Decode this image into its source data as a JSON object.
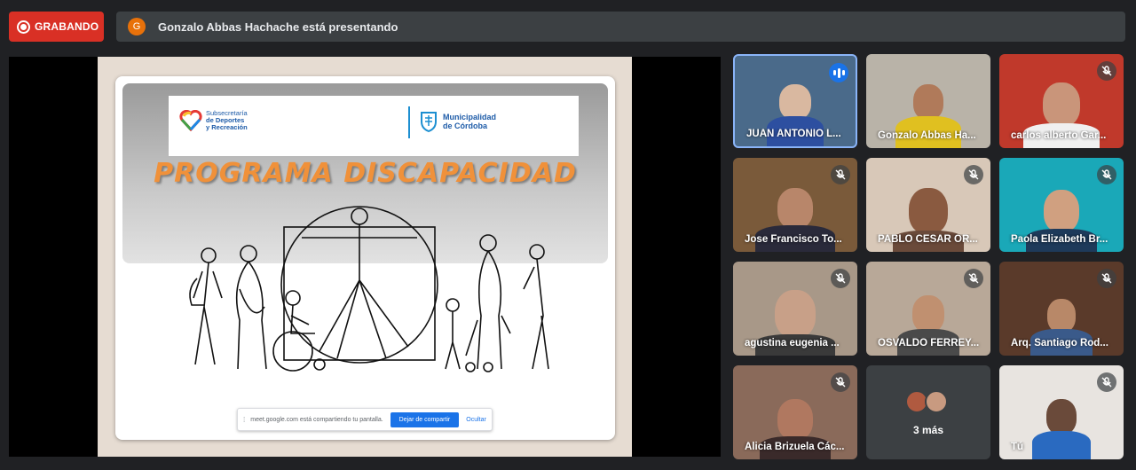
{
  "recording": {
    "label": "GRABANDO"
  },
  "presenter": {
    "initial": "G",
    "text": "Gonzalo Abbas Hachache está presentando"
  },
  "slide": {
    "title": "PROGRAMA DISCAPACIDAD",
    "logo_left_line1": "Subsecretaría",
    "logo_left_line2": "de Deportes",
    "logo_left_line3": "y Recreación",
    "logo_right_line1": "Municipalidad",
    "logo_right_line2": "de Córdoba"
  },
  "share_bar": {
    "message": "meet.google.com está compartiendo tu pantalla.",
    "stop_label": "Dejar de compartir",
    "hide_label": "Ocultar"
  },
  "participants": [
    {
      "name": "JUAN ANTONIO L...",
      "state": "speaking"
    },
    {
      "name": "Gonzalo Abbas Ha...",
      "state": "unmuted"
    },
    {
      "name": "carlos alberto Gar...",
      "state": "muted"
    },
    {
      "name": "Jose Francisco To...",
      "state": "muted"
    },
    {
      "name": "PABLO CESAR OR...",
      "state": "muted"
    },
    {
      "name": "Paola Elizabeth Br...",
      "state": "muted"
    },
    {
      "name": "agustina eugenia ...",
      "state": "muted"
    },
    {
      "name": "OSVALDO FERREY...",
      "state": "muted"
    },
    {
      "name": "Arq. Santiago Rod...",
      "state": "muted"
    },
    {
      "name": "Alicia Brizuela Các...",
      "state": "muted"
    },
    {
      "name": "Tú",
      "state": "muted"
    }
  ],
  "more": {
    "label": "3 más"
  },
  "colors": {
    "recording": "#d93025",
    "accent": "#1a73e8",
    "active_border": "#8ab4f8",
    "title": "#f0913a"
  }
}
